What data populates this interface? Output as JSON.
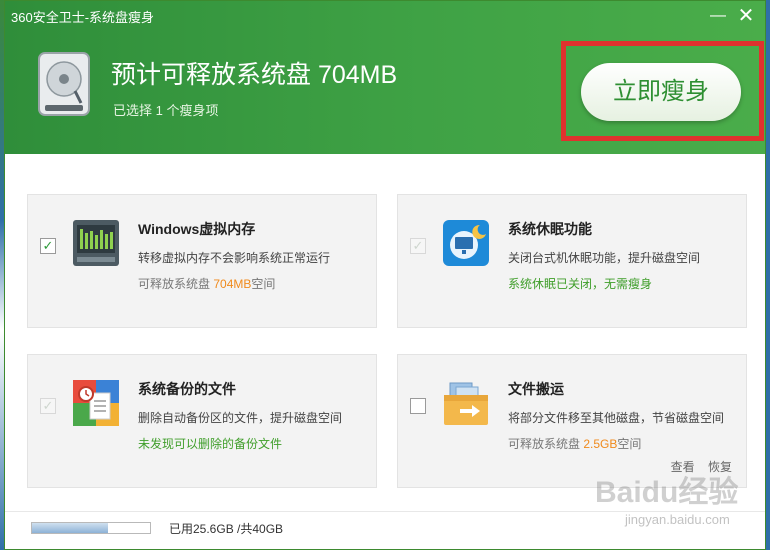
{
  "window": {
    "title": "360安全卫士-系统盘瘦身",
    "minimize_label": "—",
    "close_label": "✕"
  },
  "header": {
    "headline": "预计可释放系统盘 704MB",
    "selected": "已选择 1 个瘦身项",
    "action_button": "立即瘦身"
  },
  "items": [
    {
      "title": "Windows虚拟内存",
      "desc": "转移虚拟内存不会影响系统正常运行",
      "status_prefix": "可释放系统盘 ",
      "status_value": "704MB",
      "status_suffix": "空间",
      "checked": true,
      "enabled": true,
      "icon": "virtual-memory-icon"
    },
    {
      "title": "系统休眠功能",
      "desc": "关闭台式机休眠功能，提升磁盘空间",
      "status": "系统休眠已关闭，无需瘦身",
      "checked": true,
      "enabled": false,
      "icon": "hibernate-icon"
    },
    {
      "title": "系统备份的文件",
      "desc": "删除自动备份区的文件，提升磁盘空间",
      "status": "未发现可以删除的备份文件",
      "checked": true,
      "enabled": false,
      "icon": "backup-files-icon"
    },
    {
      "title": "文件搬运",
      "desc": "将部分文件移至其他磁盘，节省磁盘空间",
      "status_prefix": "可释放系统盘 ",
      "status_value": "2.5GB",
      "status_suffix": "空间",
      "checked": false,
      "enabled": true,
      "icon": "file-move-icon",
      "links": [
        "查看",
        "恢复"
      ]
    }
  ],
  "footer": {
    "usage": "已用25.6GB /共40GB",
    "used_fraction": 0.64
  },
  "watermark": {
    "main": "Baidu经验",
    "sub": "jingyan.baidu.com"
  },
  "colors": {
    "header_green": "#3fa245",
    "accent_orange": "#f08a1c",
    "status_green": "#3f9e2a",
    "highlight_red": "#e0322e"
  }
}
